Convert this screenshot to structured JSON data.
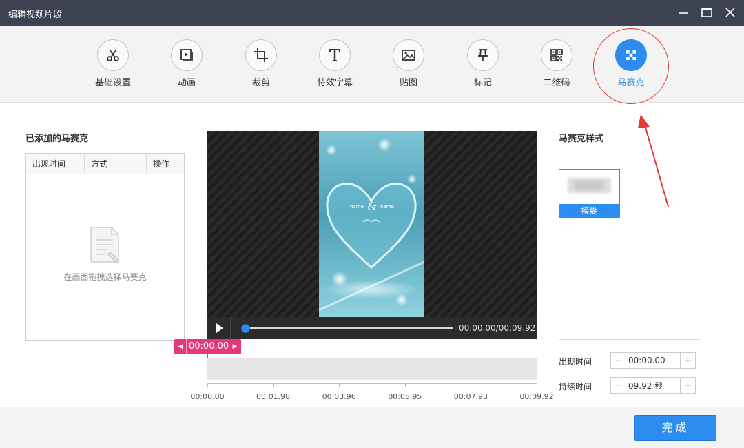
{
  "window": {
    "title": "编辑视频片段",
    "controls": [
      "minimize-icon",
      "maximize-icon",
      "close-icon"
    ]
  },
  "toolbar": {
    "tools": [
      {
        "label": "基础设置",
        "icon": "scissors-icon"
      },
      {
        "label": "动画",
        "icon": "animation-icon"
      },
      {
        "label": "裁剪",
        "icon": "crop-icon"
      },
      {
        "label": "特效字幕",
        "icon": "text-icon"
      },
      {
        "label": "贴图",
        "icon": "image-icon"
      },
      {
        "label": "标记",
        "icon": "pin-icon"
      },
      {
        "label": "二维码",
        "icon": "qrcode-icon"
      },
      {
        "label": "马赛克",
        "icon": "mosaic-icon",
        "active": true
      }
    ]
  },
  "left_panel": {
    "title": "已添加的马赛克",
    "columns": [
      "出现时间",
      "方式",
      "操作"
    ],
    "empty_text": "在画面拖拽选择马赛克"
  },
  "preview": {
    "overlay_text": {
      "left": "name",
      "symbol": "&",
      "right": "name"
    },
    "progress": 0.0,
    "timecode": "00:00.00/00:09.92"
  },
  "timeline": {
    "playhead": "00:00.00",
    "ticks": [
      "00:00.00",
      "00:01.98",
      "00:03.96",
      "00:05.95",
      "00:07.93",
      "00:09.92"
    ]
  },
  "right_panel": {
    "title": "马赛克样式",
    "style_option": "模糊",
    "start_label": "出现时间",
    "start_value": "00:00.00",
    "duration_label": "持续时间",
    "duration_value": "09.92 秒",
    "minus": "−",
    "plus": "+"
  },
  "footer": {
    "done_label": "完成"
  },
  "colors": {
    "accent": "#2d8cf0",
    "playhead": "#e4387a",
    "annotation": "#e23a35",
    "titlebar": "#3c4250"
  }
}
